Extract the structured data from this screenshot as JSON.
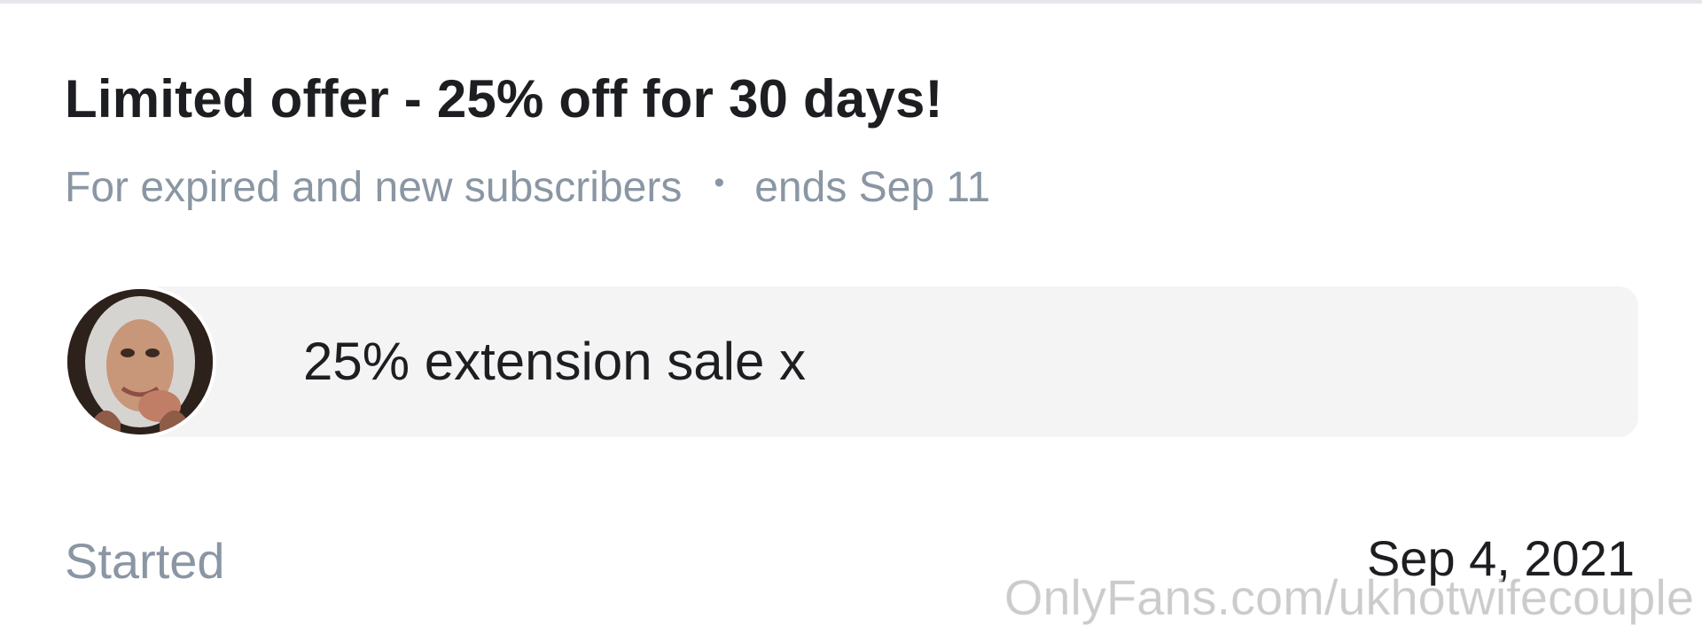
{
  "offer": {
    "title": "Limited offer - 25% off for 30 days!",
    "audience": "For expired and new subscribers",
    "separator": "•",
    "ends": "ends Sep 11"
  },
  "message": {
    "avatar_icon": "profile-photo",
    "text": "25% extension sale x"
  },
  "started": {
    "label": "Started",
    "date": "Sep 4, 2021"
  },
  "watermark": "OnlyFans.com/ukhotwifecouple",
  "colors": {
    "primary_text": "#1d1e21",
    "secondary_text": "#8a96a3",
    "bubble_bg": "#f4f4f4",
    "divider": "#e6e7ea"
  }
}
